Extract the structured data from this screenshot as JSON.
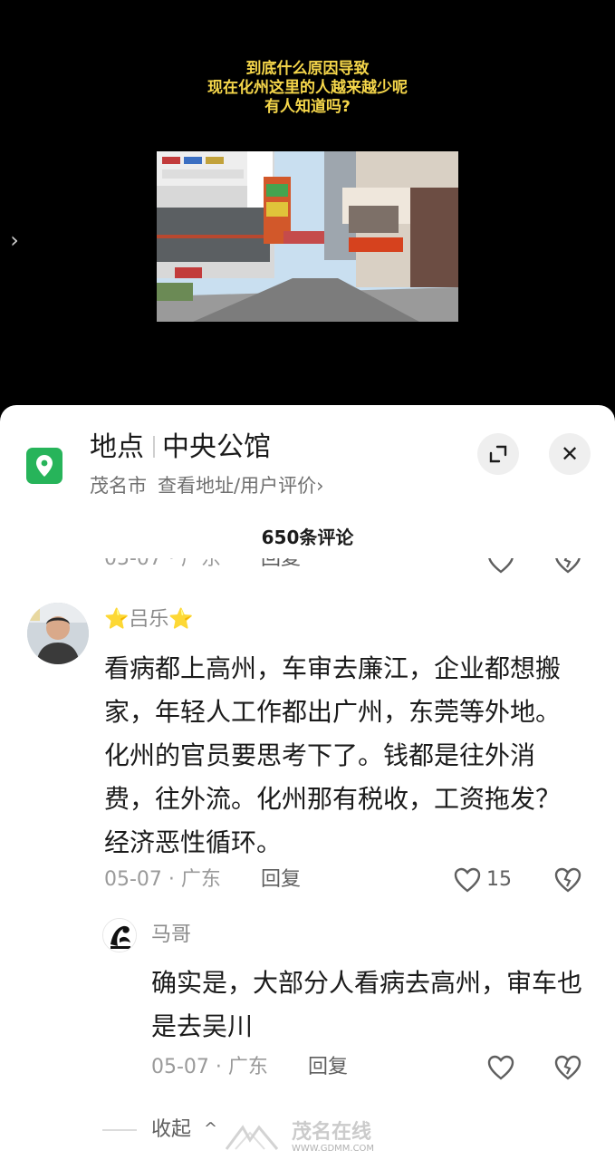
{
  "video": {
    "caption_lines": [
      "到底什么原因导致",
      "现在化州这里的人越来越少呢",
      "有人知道吗?"
    ],
    "left_arrow_icon": "chevron-right-icon"
  },
  "place": {
    "icon": "location-pin-icon",
    "label": "地点",
    "name": "中央公馆",
    "city": "茂名市",
    "link": "查看地址/用户评价",
    "link_chevron": "›",
    "expand_icon": "expand-icon",
    "close_icon": "close-icon",
    "close_glyph": "✕"
  },
  "comments_header": {
    "count_label": "650条评论"
  },
  "previous_comment": {
    "date": "05-07 · 广东",
    "reply_label": "回复"
  },
  "comment": {
    "author": "⭐吕乐⭐",
    "text": "看病都上高州，车审去廉江，企业都想搬家，年轻人工作都出广州，东莞等外地。化州的官员要思考下了。钱都是往外消费，往外流。化州那有税收，工资拖发？经济恶性循环。",
    "date": "05-07 · 广东",
    "reply_label": "回复",
    "likes": "15"
  },
  "reply": {
    "author": "马哥",
    "text": "确实是，大部分人看病去高州，审车也是去吴川",
    "date": "05-07 · 广东",
    "reply_label": "回复"
  },
  "collapse": {
    "label": "收起",
    "chevron": "^"
  },
  "watermark": {
    "text": "茂名在线",
    "url": "WWW.GDMM.COM"
  },
  "colors": {
    "accent_green": "#27b45a",
    "caption_yellow": "#f5d64a"
  }
}
